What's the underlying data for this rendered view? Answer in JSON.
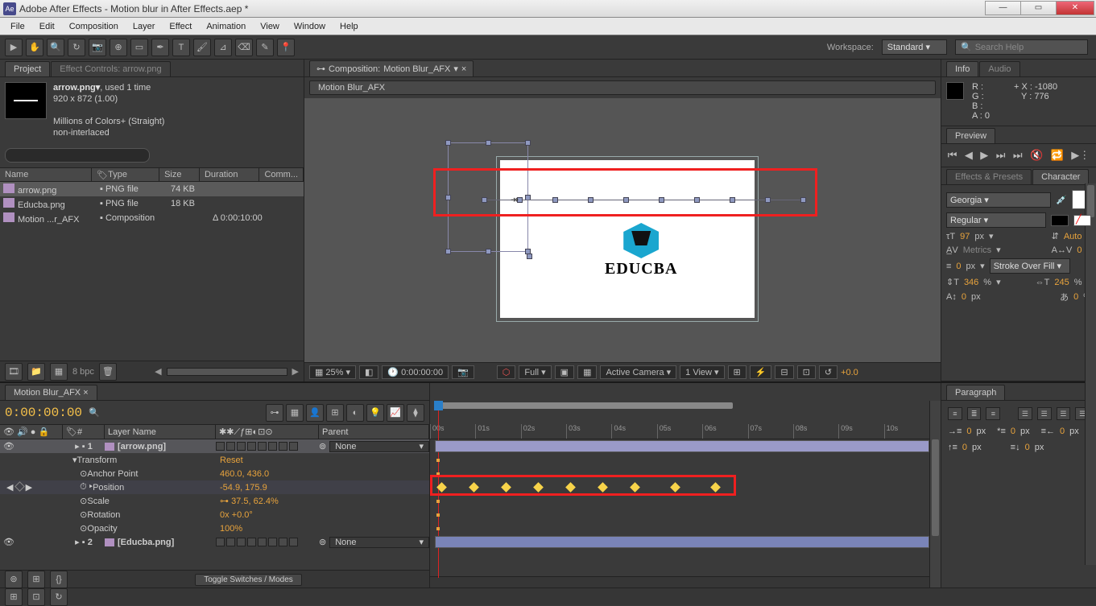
{
  "title": "Adobe After Effects - Motion blur in After Effects.aep *",
  "menu": [
    "File",
    "Edit",
    "Composition",
    "Layer",
    "Effect",
    "Animation",
    "View",
    "Window",
    "Help"
  ],
  "workspace": {
    "label": "Workspace:",
    "value": "Standard"
  },
  "search": {
    "placeholder": "Search Help"
  },
  "panels": {
    "project": "Project",
    "effectControls": "Effect Controls: arrow.png",
    "info": "Info",
    "audio": "Audio",
    "preview": "Preview",
    "effectsPresets": "Effects & Presets",
    "character": "Character",
    "paragraph": "Paragraph"
  },
  "projectItem": {
    "name": "arrow.png▾",
    "used": ", used 1 time",
    "dims": "920 x 872 (1.00)",
    "colors": "Millions of Colors+ (Straight)",
    "interlace": "non-interlaced"
  },
  "projectColumns": {
    "name": "Name",
    "type": "Type",
    "size": "Size",
    "duration": "Duration",
    "comment": "Comm..."
  },
  "projectRows": [
    {
      "name": "arrow.png",
      "type": "PNG file",
      "size": "74 KB",
      "dur": "",
      "sel": true,
      "iconColor": "#b090c0"
    },
    {
      "name": "Educba.png",
      "type": "PNG file",
      "size": "18 KB",
      "dur": "",
      "sel": false,
      "iconColor": "#b090c0"
    },
    {
      "name": "Motion ...r_AFX",
      "type": "Composition",
      "size": "",
      "dur": "Δ 0:00:10:00",
      "sel": false,
      "iconColor": "#b090c0"
    }
  ],
  "projectFoot": {
    "bpc": "8 bpc"
  },
  "compTab": {
    "prefix": "Composition:",
    "name": "Motion Blur_AFX"
  },
  "flowTab": "Motion Blur_AFX",
  "logoText": "EDUCBA",
  "compFoot": {
    "zoom": "25%",
    "time": "0:00:00:00",
    "res": "Full",
    "cam": "Active Camera",
    "view": "1 View",
    "exposure": "+0.0"
  },
  "info": {
    "r": "R :",
    "g": "G :",
    "b": "B :",
    "a": "A : 0",
    "x": "X : -1080",
    "y": "Y : 776"
  },
  "char": {
    "font": "Georgia",
    "style": "Regular",
    "size": "97",
    "sizeUnit": "px",
    "leading": "Auto",
    "kerning": "Metrics",
    "tracking": "0",
    "strokeW": "0",
    "strokeUnit": "px",
    "strokeOpt": "Stroke Over Fill",
    "vscale": "346",
    "hscale": "245",
    "pct": "%",
    "baseline": "0",
    "tsume": "0"
  },
  "tlTab": "Motion Blur_AFX",
  "tlTime": "0:00:00:00",
  "tlCols": {
    "num": "#",
    "layerName": "Layer Name",
    "parent": "Parent"
  },
  "layers": [
    {
      "num": "1",
      "name": "[arrow.png]",
      "parent": "None"
    },
    {
      "num": "2",
      "name": "[Educba.png]",
      "parent": "None"
    }
  ],
  "transform": {
    "label": "Transform",
    "reset": "Reset"
  },
  "props": {
    "anchor": {
      "label": "Anchor Point",
      "val": "460.0, 436.0"
    },
    "position": {
      "label": "Position",
      "val": "-54.9, 175.9"
    },
    "scale": {
      "label": "Scale",
      "val": "37.5, 62.4%"
    },
    "rotation": {
      "label": "Rotation",
      "val": "0x +0.0°"
    },
    "opacity": {
      "label": "Opacity",
      "val": "100%"
    }
  },
  "toggleLabel": "Toggle Switches / Modes",
  "ruler": [
    "00s",
    "01s",
    "02s",
    "03s",
    "04s",
    "05s",
    "06s",
    "07s",
    "08s",
    "09s",
    "10s"
  ],
  "para": {
    "indent": "0",
    "unit": "px"
  }
}
